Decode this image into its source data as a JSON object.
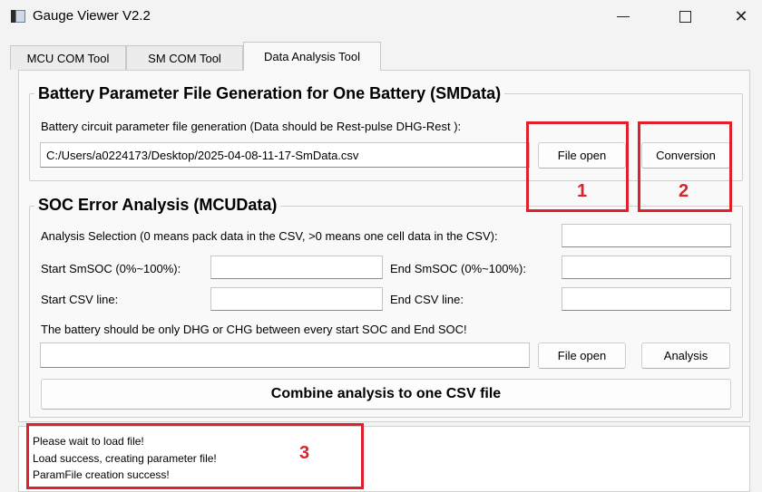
{
  "window": {
    "title": "Gauge Viewer V2.2",
    "minimize_glyph": "—",
    "close_glyph": "✕"
  },
  "tabs": [
    {
      "label": "MCU COM Tool",
      "active": false
    },
    {
      "label": "SM COM Tool",
      "active": false
    },
    {
      "label": "Data Analysis Tool",
      "active": true
    }
  ],
  "battery_param": {
    "title": "Battery Parameter File Generation for One Battery (SMData)",
    "instruction": "Battery circuit parameter file generation (Data should be Rest-pulse DHG-Rest ):",
    "path_value": "C:/Users/a0224173/Desktop/2025-04-08-11-17-SmData.csv",
    "file_open_label": "File open",
    "conversion_label": "Conversion"
  },
  "soc_error": {
    "title": "SOC Error Analysis (MCUData)",
    "analysis_selection_label": "Analysis Selection (0 means pack data in the CSV, >0 means one cell data in the CSV):",
    "analysis_selection_value": "",
    "start_smsoc_label": "Start SmSOC (0%~100%):",
    "start_smsoc_value": "",
    "end_smsoc_label": "End SmSOC (0%~100%):",
    "end_smsoc_value": "",
    "start_csv_line_label": "Start CSV line:",
    "start_csv_line_value": "",
    "end_csv_line_label": "End CSV line:",
    "end_csv_line_value": "",
    "note": "The battery should be only DHG or CHG between every start SOC and End SOC!",
    "file_path_value": "",
    "file_open_label": "File open",
    "analysis_label": "Analysis",
    "combine_label": "Combine analysis to one CSV file"
  },
  "log": {
    "lines": [
      "Please wait to load file!",
      "Load success, creating parameter file!",
      "ParamFile creation success!"
    ]
  },
  "annotations": {
    "labels": [
      "1",
      "2",
      "3"
    ],
    "color": "#e0202c"
  }
}
